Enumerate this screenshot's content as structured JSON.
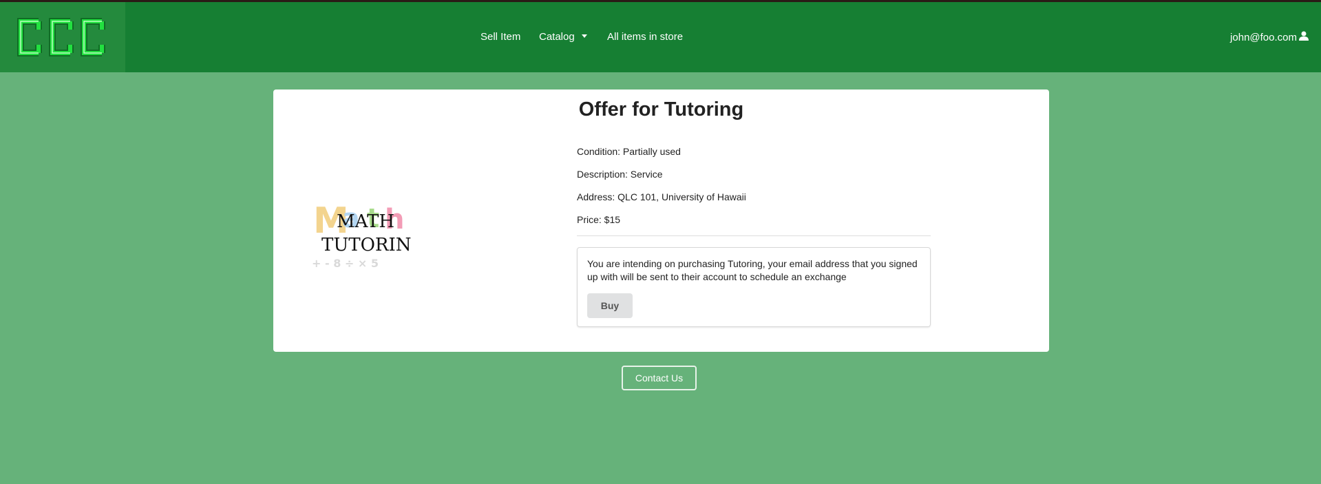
{
  "nav": {
    "logo_text": "CCC",
    "items": [
      {
        "label": "Sell Item"
      },
      {
        "label": "Catalog"
      },
      {
        "label": "All items in store"
      }
    ],
    "user_email": "john@foo.com"
  },
  "offer": {
    "title": "Offer for Tutoring",
    "condition": "Condition: Partially used",
    "description": "Description: Service",
    "address": "Address: QLC 101, University of Hawaii",
    "price": "Price: $15",
    "purchase_text": "You are intending on purchasing Tutoring, your email address that you signed up with will be sent to their account to schedule an exchange",
    "buy_label": "Buy",
    "image_text": [
      "MATH",
      "TUTORING"
    ]
  },
  "footer": {
    "contact_label": "Contact Us"
  },
  "colors": {
    "page_bg": "#66b27a",
    "navbar_bg": "#167f33",
    "logo_green": "#1fdc3a"
  }
}
